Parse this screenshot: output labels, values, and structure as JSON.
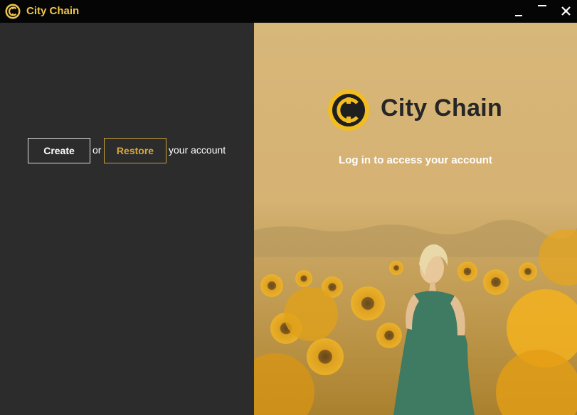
{
  "app": {
    "title": "City Chain"
  },
  "window_controls": {
    "minimize": "minimize",
    "maximize": "maximize",
    "close": "close"
  },
  "auth": {
    "create_label": "Create",
    "or_label": "or",
    "restore_label": "Restore",
    "suffix_label": "your account"
  },
  "hero": {
    "brand_name": "City Chain",
    "tagline": "Log in to access your account"
  },
  "colors": {
    "accent": "#f0c64a",
    "restore": "#d9a93a",
    "left_bg": "#2c2c2c",
    "titlebar_bg": "#050505"
  }
}
